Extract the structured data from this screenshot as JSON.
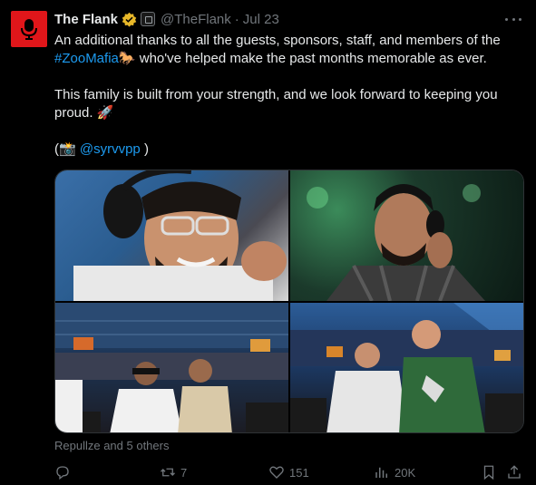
{
  "tweet": {
    "display_name": "The Flank",
    "handle": "@TheFlank",
    "separator": "·",
    "date": "Jul 23",
    "text": {
      "line1_a": "An additional thanks to all the guests, sponsors, staff, and members of the",
      "hashtag": "#ZooMafia",
      "line1_b_emoji": "🐎",
      "line2_rest": " who've helped make the past months memorable as ever.",
      "paragraph2": "This family is built from your strength, and we look forward to keeping you proud.",
      "paragraph2_emoji": "🚀",
      "credit_open": "(",
      "credit_emoji": "📸",
      "credit_mention": "@syrvvpp",
      "credit_close": " )"
    },
    "reactions_text": "Repullze and 5 others"
  },
  "actions": {
    "reply_count": "",
    "retweet_count": "7",
    "like_count": "151",
    "views_count": "20K"
  },
  "colors": {
    "background": "#000000",
    "text": "#e7e9ea",
    "secondary": "#71767b",
    "link": "#1d9bf0",
    "avatar_bg": "#e0161a",
    "verified_gold": "#e8b829"
  },
  "icons": [
    "microphone-logo-icon",
    "verified-badge-icon",
    "affiliate-badge-icon",
    "more-icon",
    "reply-icon",
    "retweet-icon",
    "like-icon",
    "views-icon",
    "bookmark-icon",
    "share-icon"
  ]
}
